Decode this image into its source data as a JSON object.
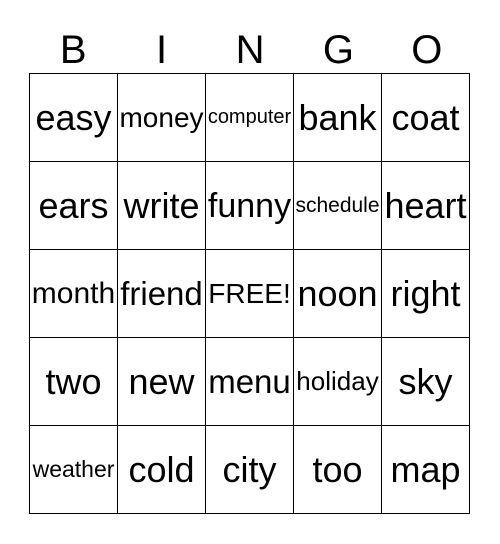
{
  "header": [
    "B",
    "I",
    "N",
    "G",
    "O"
  ],
  "grid": [
    [
      "easy",
      "money",
      "computer",
      "bank",
      "coat"
    ],
    [
      "ears",
      "write",
      "funny",
      "schedule",
      "heart"
    ],
    [
      "month",
      "friend",
      "FREE!",
      "noon",
      "right"
    ],
    [
      "two",
      "new",
      "menu",
      "holiday",
      "sky"
    ],
    [
      "weather",
      "cold",
      "city",
      "too",
      "map"
    ]
  ]
}
